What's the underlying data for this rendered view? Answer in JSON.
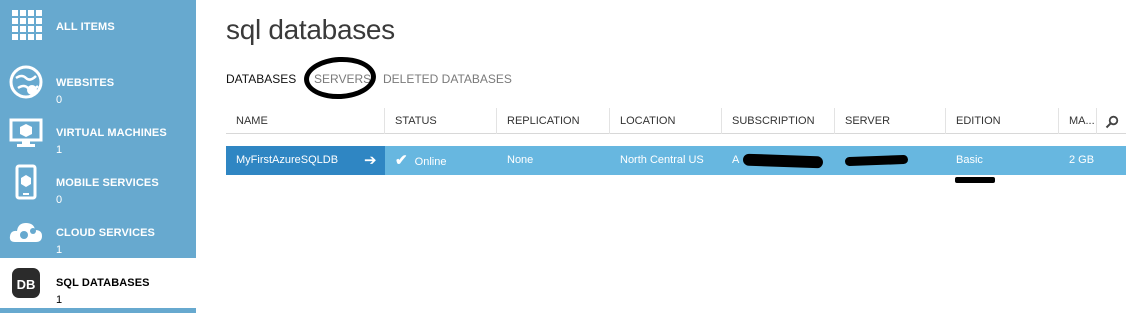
{
  "sidebar": {
    "items": [
      {
        "label": "ALL ITEMS",
        "count": "",
        "icon": "grid-icon"
      },
      {
        "label": "WEBSITES",
        "count": "0",
        "icon": "globe-icon"
      },
      {
        "label": "VIRTUAL MACHINES",
        "count": "1",
        "icon": "monitor-icon"
      },
      {
        "label": "MOBILE SERVICES",
        "count": "0",
        "icon": "phone-icon"
      },
      {
        "label": "CLOUD SERVICES",
        "count": "1",
        "icon": "cloud-gear-icon"
      },
      {
        "label": "SQL DATABASES",
        "count": "1",
        "icon": "db-icon",
        "icon_text": "DB"
      }
    ]
  },
  "main": {
    "title": "sql databases",
    "tabs": [
      "DATABASES",
      "SERVERS",
      "DELETED DATABASES"
    ],
    "columns": [
      "NAME",
      "STATUS",
      "REPLICATION",
      "LOCATION",
      "SUBSCRIPTION",
      "SERVER",
      "EDITION",
      "MA..."
    ],
    "rows": [
      {
        "name": "MyFirstAzureSQLDB",
        "status": "Online",
        "replication": "None",
        "location": "North Central US",
        "subscription": "A",
        "server": "",
        "edition": "Basic",
        "max_size": "2 GB"
      }
    ]
  },
  "colors": {
    "sidebar_bg": "#67a9cf",
    "selected_row": "#67b7e0",
    "name_cell": "#2f86c3"
  }
}
